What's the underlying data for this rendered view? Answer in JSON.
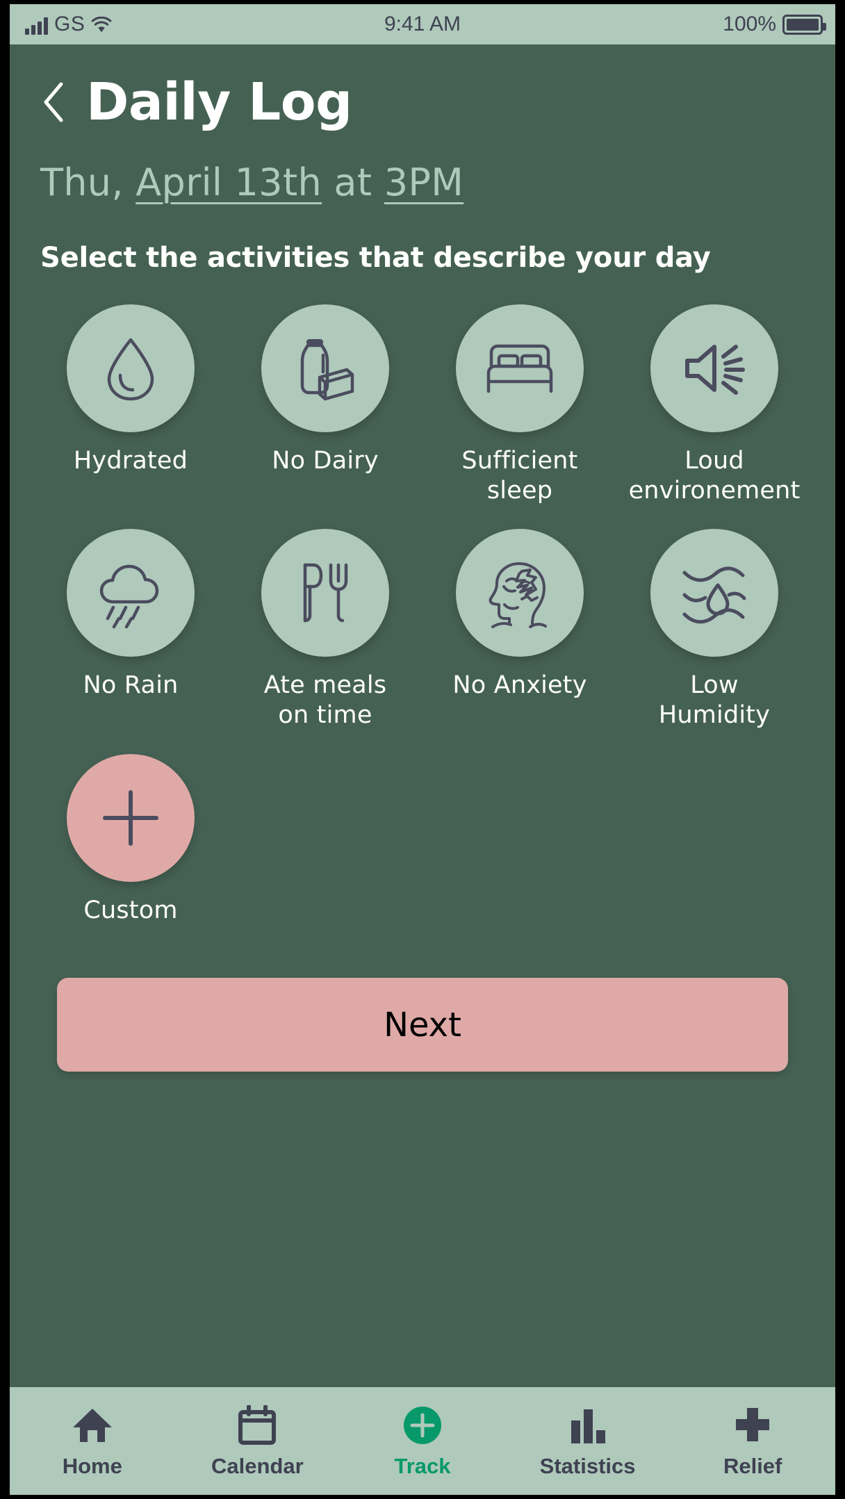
{
  "status_bar": {
    "carrier": "GS",
    "time": "9:41 AM",
    "battery_percent": "100%",
    "signal_icon": "signal-bars-icon",
    "wifi_icon": "wifi-icon",
    "battery_icon": "battery-full-icon"
  },
  "header": {
    "back_icon": "chevron-left-icon",
    "title": "Daily Log"
  },
  "date": {
    "prefix": "Thu, ",
    "date_link": "April 13th",
    "middle": " at ",
    "time_link": "3PM"
  },
  "prompt": "Select the activities that describe your day",
  "activities": [
    {
      "label": "Hydrated",
      "icon": "water-drop-icon",
      "selected": false
    },
    {
      "label": "No Dairy",
      "icon": "milk-cheese-icon",
      "selected": false
    },
    {
      "label": "Sufficient\nsleep",
      "icon": "bed-icon",
      "selected": false
    },
    {
      "label": "Loud\nenvironement",
      "icon": "speaker-loud-icon",
      "selected": false
    },
    {
      "label": "No Rain",
      "icon": "rain-cloud-icon",
      "selected": false
    },
    {
      "label": "Ate meals\non time",
      "icon": "knife-fork-icon",
      "selected": false
    },
    {
      "label": "No Anxiety",
      "icon": "head-tangle-icon",
      "selected": false
    },
    {
      "label": "Low\nHumidity",
      "icon": "humidity-icon",
      "selected": false
    },
    {
      "label": "Custom",
      "icon": "plus-icon",
      "selected": false
    }
  ],
  "next_button": "Next",
  "tabbar": {
    "items": [
      {
        "label": "Home",
        "icon": "home-icon",
        "active": false
      },
      {
        "label": "Calendar",
        "icon": "calendar-icon",
        "active": false
      },
      {
        "label": "Track",
        "icon": "plus-circle-icon",
        "active": true
      },
      {
        "label": "Statistics",
        "icon": "bar-chart-icon",
        "active": false
      },
      {
        "label": "Relief",
        "icon": "medical-cross-icon",
        "active": false
      }
    ]
  },
  "colors": {
    "background": "#456153",
    "surface": "#afc9bb",
    "accent_pink": "#dfa9a7",
    "ink": "#3f4251",
    "active_green": "#07996a"
  }
}
